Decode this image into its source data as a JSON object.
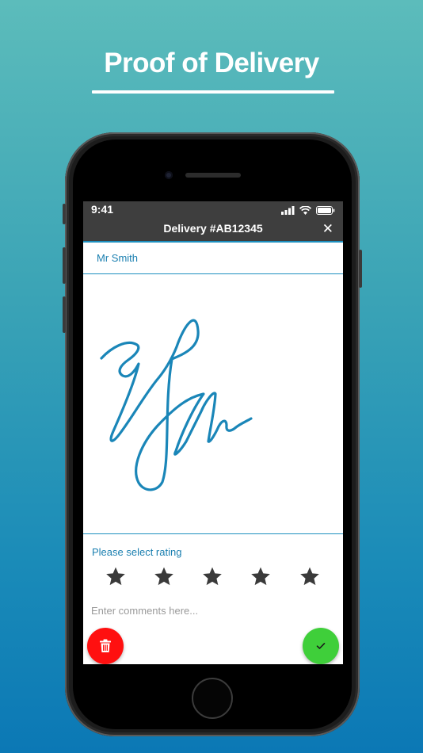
{
  "headline": "Proof of Delivery",
  "status_bar": {
    "time": "9:41"
  },
  "nav": {
    "title": "Delivery #AB12345",
    "close_glyph": "✕"
  },
  "form": {
    "recipient_name": "Mr Smith",
    "rating_label": "Please select rating",
    "rating": {
      "max": 5,
      "selected": 5
    },
    "comments_placeholder": "Enter comments here...",
    "delete_glyph": "🗑",
    "confirm_glyph": "✓"
  },
  "colors": {
    "accent": "#1d8fbf",
    "signature_ink": "#1a86b8",
    "delete": "#ff1010",
    "confirm": "#3fcf3a",
    "nav_bg": "#3e3e3e"
  },
  "icons": [
    "signal-icon",
    "wifi-icon",
    "battery-icon",
    "close-icon",
    "star-icon",
    "trash-icon",
    "check-icon"
  ]
}
